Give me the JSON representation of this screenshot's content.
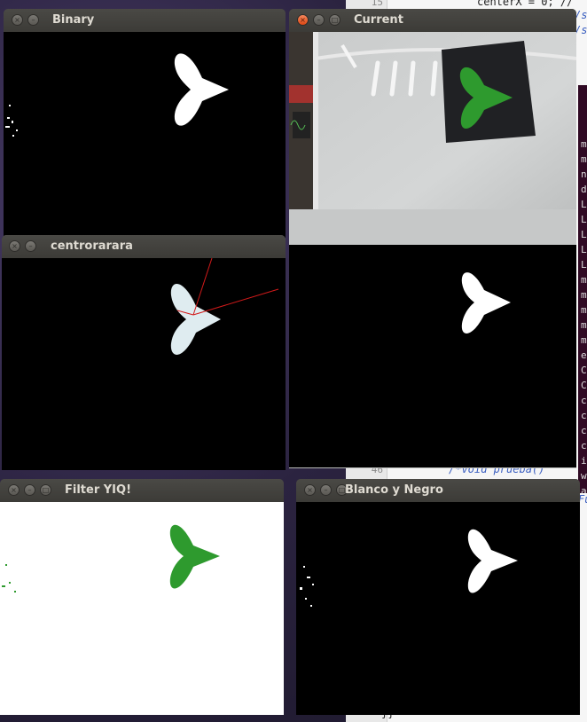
{
  "windows": {
    "binary": {
      "title": "Binary"
    },
    "current": {
      "title": "Current"
    },
    "centro": {
      "title": "centrorarara"
    },
    "filter": {
      "title": "Filter YIQ!"
    },
    "bn": {
      "title": "Blanco y Negro"
    }
  },
  "editor": {
    "line_top": {
      "num": "15",
      "text": "centerX = 0; //"
    },
    "line_prueba": {
      "num": "46",
      "text": "/*void prueba()"
    },
    "line_fu": {
      "text": "Fu"
    },
    "comment_se1": "/se",
    "comment_se2": "/se",
    "bottom_text": "}}",
    "term_chars": [
      "m",
      "m",
      "n",
      "d",
      "L",
      "L",
      "L",
      "L",
      "L",
      "m",
      "m",
      "m",
      "m",
      "m",
      "e",
      "C",
      "C",
      "c",
      "c",
      "c",
      "c",
      "i",
      "w",
      "a"
    ]
  },
  "colors": {
    "heart_white": "#ffffff",
    "heart_green": "#2e9a2e",
    "centro_heart": "#dfecf0",
    "lines": "#d21a1a"
  }
}
